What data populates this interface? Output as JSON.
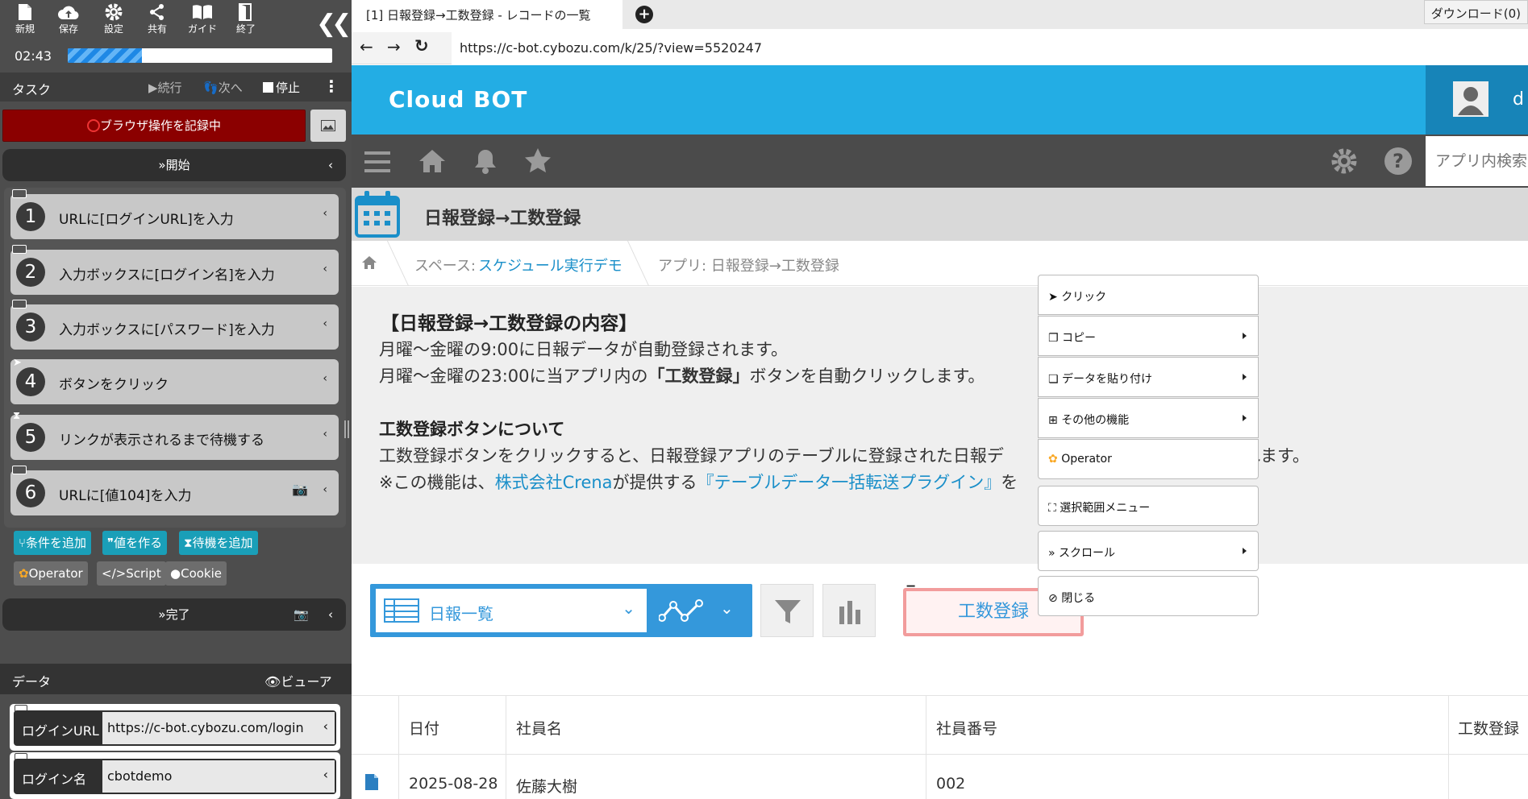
{
  "toolbar": {
    "new": "新規",
    "save": "保存",
    "settings": "設定",
    "share": "共有",
    "guide": "ガイド",
    "exit": "終了"
  },
  "timer": "02:43",
  "progress": 0.28,
  "task": {
    "label": "タスク",
    "continue": "続行",
    "next": "次へ",
    "stop": "停止"
  },
  "record": {
    "label": "ブラウザ操作を記録中"
  },
  "start": {
    "label": "開始"
  },
  "steps": [
    {
      "num": "1",
      "label": "URLに[ログインURL]を入力"
    },
    {
      "num": "2",
      "label": "入力ボックスに[ログイン名]を入力"
    },
    {
      "num": "3",
      "label": "入力ボックスに[パスワード]を入力"
    },
    {
      "num": "4",
      "label": "ボタンをクリック"
    },
    {
      "num": "5",
      "label": "リンクが表示されるまで待機する"
    },
    {
      "num": "6",
      "label": "URLに[値104]を入力"
    }
  ],
  "actions": {
    "add_condition": "条件を追加",
    "make_value": "値を作る",
    "add_wait": "待機を追加",
    "operator": "Operator",
    "script": "Script",
    "cookie": "Cookie"
  },
  "finish": {
    "label": "完了"
  },
  "data_panel": {
    "label": "データ",
    "viewer": "ビューア",
    "fields": [
      {
        "label": "ログインURL",
        "value": "https://c-bot.cybozu.com/login"
      },
      {
        "label": "ログイン名",
        "value": "cbotdemo"
      }
    ]
  },
  "browser": {
    "tab_title": "[1] 日報登録→工数登録 - レコードの一覧",
    "download": "ダウンロード(0)",
    "url": "https://c-bot.cybozu.com/k/25/?view=5520247"
  },
  "kintone": {
    "brand": "Cloud BOT",
    "user_initial": "d",
    "search_placeholder": "アプリ内検索",
    "app_title": "日報登録→工数登録",
    "breadcrumb": {
      "space_prefix": "スペース:",
      "space_name": "スケジュール実行デモ",
      "app": "アプリ: 日報登録→工数登録"
    },
    "desc": {
      "h1": "【日報登録→工数登録の内容】",
      "l1": "月曜〜金曜の9:00に日報データが自動登録されます。",
      "l2a": "月曜〜金曜の23:00に当アプリ内の",
      "l2b": "「工数登録」",
      "l2c": "ボタンを自動クリックします。",
      "h2": "工数登録ボタンについて",
      "l3a": "工数登録ボタンをクリックすると、日報登録アプリのテーブルに登録された日報デ",
      "l3b": "ーコード単位で登録されます。",
      "l4a": "※この機能は、",
      "l4b": "株式会社Crena",
      "l4c": "が提供する",
      "l4d": "『テーブルデータ一括転送プラグイン』",
      "l4e": "を"
    },
    "view_name": "日報一覧",
    "koosu_button": "工数登録",
    "table": {
      "headers": [
        "日付",
        "社員名",
        "社員番号",
        "工数登録"
      ],
      "row": [
        "2025-08-28",
        "佐藤大樹",
        "002"
      ]
    }
  },
  "context_menu": [
    "クリック",
    "コピー",
    "データを貼り付け",
    "その他の機能",
    "Operator",
    "選択範囲メニュー",
    "スクロール",
    "閉じる"
  ]
}
